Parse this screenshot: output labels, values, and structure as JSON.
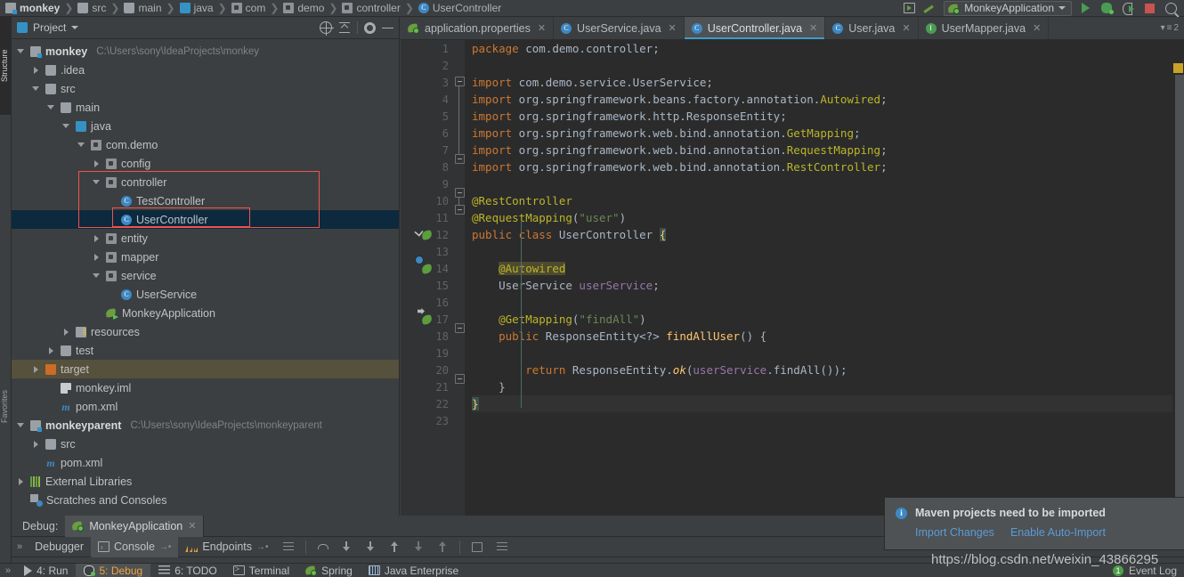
{
  "breadcrumbs": [
    {
      "label": "monkey",
      "icon": "module-icon"
    },
    {
      "label": "src",
      "icon": "folder-icon"
    },
    {
      "label": "main",
      "icon": "folder-icon"
    },
    {
      "label": "java",
      "icon": "source-folder-icon"
    },
    {
      "label": "com",
      "icon": "package-icon"
    },
    {
      "label": "demo",
      "icon": "package-icon"
    },
    {
      "label": "controller",
      "icon": "package-icon"
    },
    {
      "label": "UserController",
      "icon": "class-icon"
    }
  ],
  "toolbar": {
    "run_configuration": "MonkeyApplication",
    "run_label": "Run",
    "debug_label": "Debug",
    "coverage_label": "Run with Coverage",
    "stop_label": "Stop",
    "search_label": "Search Everywhere",
    "build_label": "Build Project",
    "run_anything_label": "Run Anything"
  },
  "left_strip": [
    {
      "label": "Structure",
      "selected": false
    },
    {
      "label": "Favorites",
      "selected": false
    }
  ],
  "project_pane": {
    "title": "Project",
    "locate_label": "Select Opened File",
    "collapse_label": "Collapse All",
    "settings_label": "Settings",
    "hide_label": "Hide",
    "tree": [
      {
        "label": "monkey",
        "path": "C:\\Users\\sony\\IdeaProjects\\monkey",
        "indent": 0,
        "arrow": "open",
        "icon": "module-icon",
        "bold": true
      },
      {
        "label": ".idea",
        "path": "",
        "indent": 1,
        "arrow": "closed",
        "icon": "folder-icon",
        "bold": false
      },
      {
        "label": "src",
        "path": "",
        "indent": 1,
        "arrow": "open",
        "icon": "folder-icon",
        "bold": false
      },
      {
        "label": "main",
        "path": "",
        "indent": 2,
        "arrow": "open",
        "icon": "folder-icon",
        "bold": false
      },
      {
        "label": "java",
        "path": "",
        "indent": 3,
        "arrow": "open",
        "icon": "source-folder-icon",
        "bold": false
      },
      {
        "label": "com.demo",
        "path": "",
        "indent": 4,
        "arrow": "open",
        "icon": "package-icon",
        "bold": false
      },
      {
        "label": "config",
        "path": "",
        "indent": 5,
        "arrow": "closed",
        "icon": "package-icon",
        "bold": false
      },
      {
        "label": "controller",
        "path": "",
        "indent": 5,
        "arrow": "open",
        "icon": "package-icon",
        "bold": false
      },
      {
        "label": "TestController",
        "path": "",
        "indent": 6,
        "arrow": "none",
        "icon": "class-icon",
        "bold": false
      },
      {
        "label": "UserController",
        "path": "",
        "indent": 6,
        "arrow": "none",
        "icon": "class-icon",
        "bold": false,
        "selected": true
      },
      {
        "label": "entity",
        "path": "",
        "indent": 5,
        "arrow": "closed",
        "icon": "package-icon",
        "bold": false
      },
      {
        "label": "mapper",
        "path": "",
        "indent": 5,
        "arrow": "closed",
        "icon": "package-icon",
        "bold": false
      },
      {
        "label": "service",
        "path": "",
        "indent": 5,
        "arrow": "open",
        "icon": "package-icon",
        "bold": false
      },
      {
        "label": "UserService",
        "path": "",
        "indent": 6,
        "arrow": "none",
        "icon": "class-icon",
        "bold": false
      },
      {
        "label": "MonkeyApplication",
        "path": "",
        "indent": 5,
        "arrow": "none",
        "icon": "spring-app-icon",
        "bold": false
      },
      {
        "label": "resources",
        "path": "",
        "indent": 3,
        "arrow": "closed",
        "icon": "resources-folder-icon",
        "bold": false
      },
      {
        "label": "test",
        "path": "",
        "indent": 2,
        "arrow": "closed",
        "icon": "folder-icon",
        "bold": false
      },
      {
        "label": "target",
        "path": "",
        "indent": 1,
        "arrow": "closed",
        "icon": "target-folder-icon",
        "bold": false,
        "target": true
      },
      {
        "label": "monkey.iml",
        "path": "",
        "indent": 2,
        "arrow": "none",
        "icon": "iml-file-icon",
        "bold": false
      },
      {
        "label": "pom.xml",
        "path": "",
        "indent": 2,
        "arrow": "none",
        "icon": "maven-file-icon",
        "bold": false
      },
      {
        "label": "monkeyparent",
        "path": "C:\\Users\\sony\\IdeaProjects\\monkeyparent",
        "indent": 0,
        "arrow": "open",
        "icon": "module-icon",
        "bold": true
      },
      {
        "label": "src",
        "path": "",
        "indent": 1,
        "arrow": "closed",
        "icon": "folder-icon",
        "bold": false
      },
      {
        "label": "pom.xml",
        "path": "",
        "indent": 1,
        "arrow": "none",
        "icon": "maven-file-icon",
        "bold": false
      },
      {
        "label": "External Libraries",
        "path": "",
        "indent": 0,
        "arrow": "closed",
        "icon": "libraries-icon",
        "bold": false
      },
      {
        "label": "Scratches and Consoles",
        "path": "",
        "indent": 0,
        "arrow": "none",
        "icon": "scratches-icon",
        "bold": false
      }
    ]
  },
  "editor": {
    "tabs": [
      {
        "label": "application.properties",
        "icon": "spring-properties-icon",
        "active": false,
        "closable": true
      },
      {
        "label": "UserService.java",
        "icon": "class-icon",
        "active": false,
        "closable": true
      },
      {
        "label": "UserController.java",
        "icon": "class-icon",
        "active": true,
        "closable": true
      },
      {
        "label": "User.java",
        "icon": "class-icon",
        "active": false,
        "closable": true
      },
      {
        "label": "UserMapper.java",
        "icon": "interface-icon",
        "active": false,
        "closable": true
      }
    ],
    "tab_overflow_count": "2",
    "line_numbers": [
      "1",
      "2",
      "3",
      "4",
      "5",
      "6",
      "7",
      "8",
      "9",
      "10",
      "11",
      "12",
      "13",
      "14",
      "15",
      "16",
      "17",
      "18",
      "19",
      "20",
      "21",
      "22",
      "23"
    ],
    "code_lines": [
      "package com.demo.controller;",
      "",
      "import com.demo.service.UserService;",
      "import org.springframework.beans.factory.annotation.Autowired;",
      "import org.springframework.http.ResponseEntity;",
      "import org.springframework.web.bind.annotation.GetMapping;",
      "import org.springframework.web.bind.annotation.RequestMapping;",
      "import org.springframework.web.bind.annotation.RestController;",
      "",
      "@RestController",
      "@RequestMapping(\"user\")",
      "public class UserController {",
      "",
      "    @Autowired",
      "    UserService userService;",
      "",
      "    @GetMapping(\"findAll\")",
      "    public ResponseEntity<?> findAllUser() {",
      "",
      "        return ResponseEntity.ok(userService.findAll());",
      "    }",
      "}",
      ""
    ],
    "caret_line": "22"
  },
  "debug_panel": {
    "run_label": "Debug:",
    "config_tab": "MonkeyApplication",
    "tabs": [
      {
        "label": "Debugger",
        "icon": "",
        "active": false
      },
      {
        "label": "Console",
        "icon": "console-icon",
        "active": true
      },
      {
        "label": "Endpoints",
        "icon": "endpoints-icon",
        "active": false
      }
    ]
  },
  "status_bar": {
    "items": [
      {
        "label": "4: Run",
        "icon": "run-icon",
        "active": false
      },
      {
        "label": "5: Debug",
        "icon": "debug-icon",
        "active": true
      },
      {
        "label": "6: TODO",
        "icon": "todo-icon",
        "active": false
      },
      {
        "label": "Terminal",
        "icon": "terminal-icon",
        "active": false
      },
      {
        "label": "Spring",
        "icon": "spring-icon",
        "active": false
      },
      {
        "label": "Java Enterprise",
        "icon": "java-enterprise-icon",
        "active": false
      }
    ],
    "event_log": "Event Log",
    "event_log_count": "1"
  },
  "notification": {
    "icon": "info-icon",
    "title": "Maven projects need to be imported",
    "actions": [
      "Import Changes",
      "Enable Auto-Import"
    ]
  },
  "watermark": "https://blog.csdn.net/weixin_43866295",
  "colors": {
    "accent": "#3d9cc9",
    "link": "#5b9bd5",
    "selection": "#0d293e",
    "annotation_box": "#f0534f",
    "keyword": "#cc7832",
    "string": "#6a8759",
    "annotation": "#bbb529",
    "field": "#9876aa",
    "method": "#ffc66d"
  }
}
